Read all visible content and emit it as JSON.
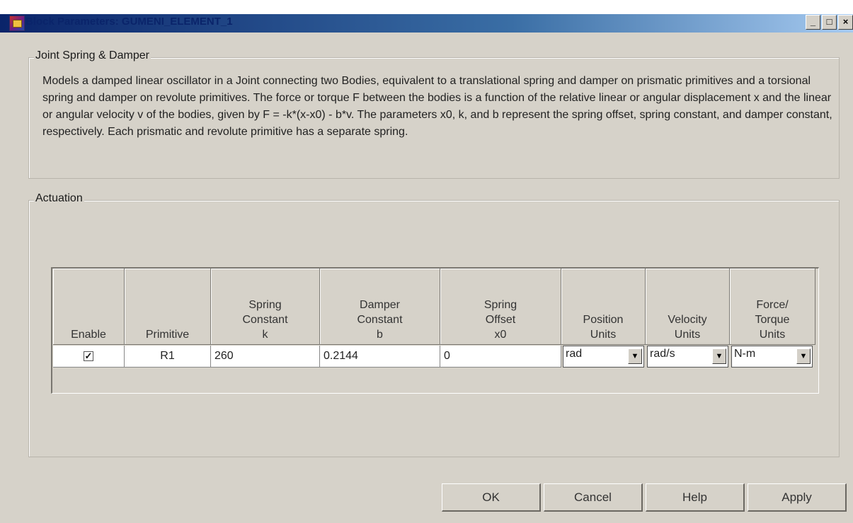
{
  "window": {
    "title": "Block Parameters: GUMENI_ELEMENT_1",
    "controls": [
      "_",
      "□",
      "×"
    ]
  },
  "description_group": {
    "legend": "Joint Spring & Damper",
    "text": "Models a damped linear oscillator in a Joint connecting two Bodies, equivalent to a translational spring and damper on prismatic primitives and a torsional spring and damper on revolute primitives. The force or torque F between the bodies is a function of the relative linear or angular displacement x and the linear or angular velocity v of the bodies, given by F = -k*(x-x0) - b*v. The parameters x0, k, and b represent the spring offset, spring constant, and damper constant, respectively. Each prismatic and revolute primitive has a separate spring."
  },
  "actuation_group": {
    "legend": "Actuation",
    "columns": [
      [
        "Enable"
      ],
      [
        "Primitive"
      ],
      [
        "Spring",
        "Constant",
        "k"
      ],
      [
        "Damper",
        "Constant",
        "b"
      ],
      [
        "Spring",
        "Offset",
        "x0"
      ],
      [
        "Position",
        "Units"
      ],
      [
        "Velocity",
        "Units"
      ],
      [
        "Force/",
        "Torque",
        "Units"
      ]
    ],
    "row": {
      "enable_checked": true,
      "check_mark": "✓",
      "primitive": "R1",
      "spring_constant": "260",
      "damper_constant": "0.2144",
      "spring_offset": "0",
      "position_units": "rad",
      "velocity_units": "rad/s",
      "force_torque_units": "N-m",
      "dropdown_arrow": "▼"
    }
  },
  "buttons": {
    "ok": "OK",
    "cancel": "Cancel",
    "help": "Help",
    "apply": "Apply"
  }
}
